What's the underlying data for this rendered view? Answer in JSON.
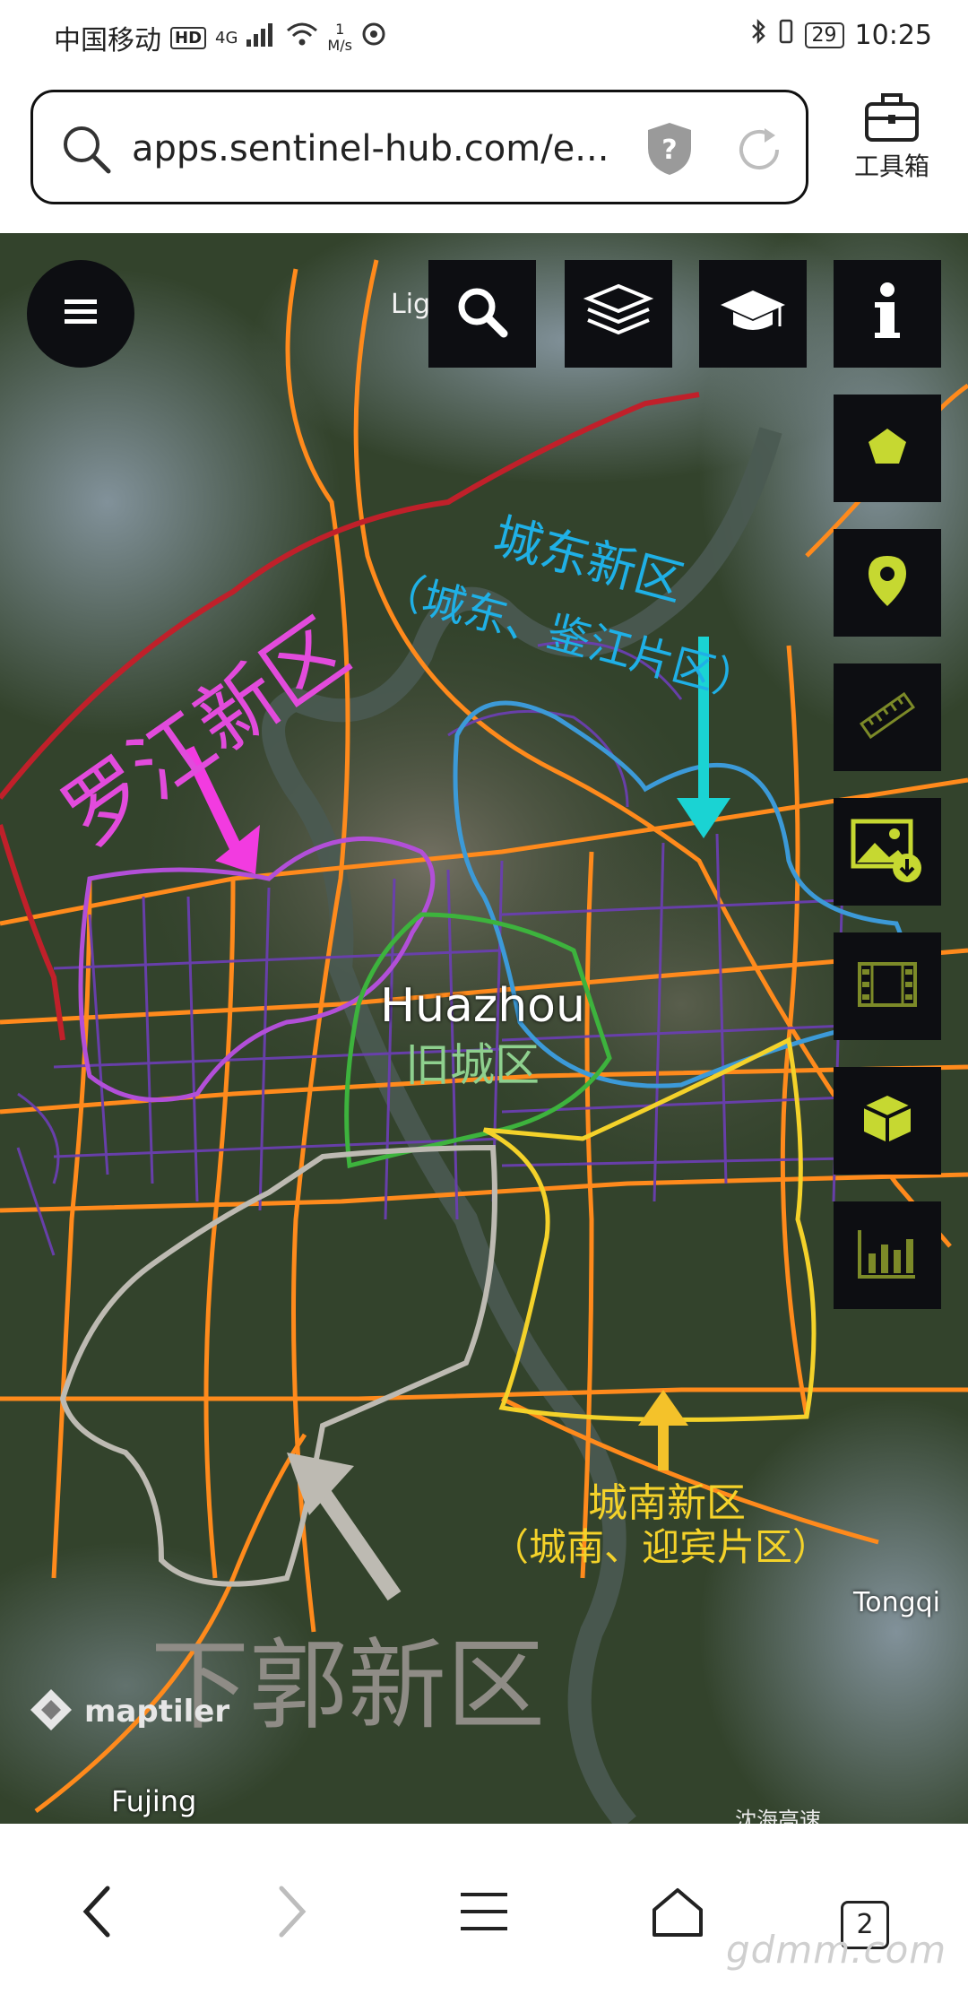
{
  "status_bar": {
    "carrier": "中国移动",
    "network": "4G",
    "speed_value": "1",
    "speed_unit": "M/s",
    "battery": "29",
    "time": "10:25"
  },
  "browser": {
    "url": "apps.sentinel-hub.com/e...",
    "toolbox_label": "工具箱",
    "tab_count": "2"
  },
  "map": {
    "place_labels": {
      "top": "Lig",
      "city": "Huazhou",
      "east": "Tongqi",
      "southwest": "Fujing",
      "bottom": "沈海高速"
    },
    "annotations": {
      "luojiang": "罗江新区",
      "chengdong_title": "城东新区",
      "chengdong_sub": "（城东、鉴江片区）",
      "old_town": "旧城区",
      "chengnan_title": "城南新区",
      "chengnan_sub": "（城南、迎宾片区）",
      "xiaguo": "下郭新区"
    },
    "attribution": "maptiler",
    "toolbar_icons": [
      "search-icon",
      "layers-icon",
      "education-icon",
      "info-icon"
    ],
    "side_tools": [
      "polygon-icon",
      "pin-icon",
      "ruler-icon",
      "image-download-icon",
      "film-icon",
      "cube-icon",
      "chart-icon"
    ]
  },
  "watermark": "gdmm.com",
  "colors": {
    "tool_accent": "#c6d831",
    "button_bg": "#0d0e12",
    "road_orange": "#ff8a1c",
    "road_purple": "#6a3fb0",
    "luojiang_magenta": "#e24bdc",
    "chengdong_cyan": "#1fb0e6",
    "chengnan_yellow": "#f4d22a",
    "xiaguo_gray": "#bdbab2",
    "oldtown_green": "#5cc05c",
    "boundary_red": "#c0202a"
  }
}
